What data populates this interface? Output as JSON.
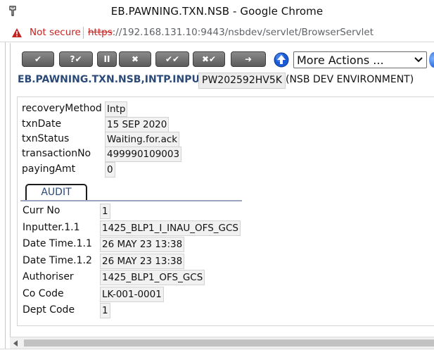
{
  "window": {
    "title": "EB.PAWNING.TXN.NSB - Google Chrome"
  },
  "addressbar": {
    "security_text": "Not secure",
    "url_scheme": "https",
    "url_rest": "://192.168.131.10:9443/nsbdev/servlet/BrowserServlet"
  },
  "toolbar": {
    "buttons": [
      {
        "name": "commit-button",
        "glyph": "✔"
      },
      {
        "name": "validate-button",
        "glyph": "?✔"
      },
      {
        "name": "hold-button",
        "glyph": "II"
      },
      {
        "name": "delete-button",
        "glyph": "✖"
      },
      {
        "name": "authorise-button",
        "glyph": "✔✔"
      },
      {
        "name": "reverse-button",
        "glyph": "✖✔"
      },
      {
        "name": "next-button",
        "glyph": "➜"
      }
    ],
    "more_actions_label": "More Actions ...",
    "colors": {
      "button": "#6e6e6e",
      "help": "#1b5bd6"
    }
  },
  "heading": {
    "app_name": "EB.PAWNING.TXN.NSB,INTP.INPUT",
    "txn_id": "PW202592HV5K",
    "environment": "(NSB DEV ENVIRONMENT)"
  },
  "fields": [
    {
      "label": "recoveryMethod",
      "value": "Intp"
    },
    {
      "label": "txnDate",
      "value": "15 SEP 2020"
    },
    {
      "label": "txnStatus",
      "value": "Waiting.for.ack"
    },
    {
      "label": "transactionNo",
      "value": "499990109003"
    },
    {
      "label": "payingAmt",
      "value": "0"
    }
  ],
  "audit": {
    "tab_label": "AUDIT",
    "fields": [
      {
        "label": "Curr No",
        "value": "1"
      },
      {
        "label": "Inputter.1.1",
        "value": "1425_BLP1_I_INAU_OFS_GCS"
      },
      {
        "label": "Date Time.1.1",
        "value": "26 MAY 23 13:38"
      },
      {
        "label": "Date Time.1.2",
        "value": "26 MAY 23 13:38"
      },
      {
        "label": "Authoriser",
        "value": "1425_BLP1_OFS_GCS"
      },
      {
        "label": "Co Code",
        "value": "LK-001-0001"
      },
      {
        "label": "Dept Code",
        "value": "1"
      }
    ]
  }
}
